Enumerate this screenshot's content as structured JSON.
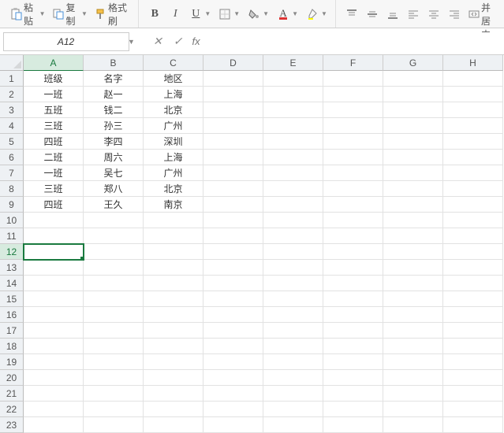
{
  "toolbar": {
    "paste_label": "粘贴",
    "copy_label": "复制",
    "format_painter_label": "格式刷",
    "merge_label": "合并居中"
  },
  "formula_bar": {
    "namebox_value": "A12",
    "fx_label": "fx",
    "formula_value": ""
  },
  "columns": [
    "A",
    "B",
    "C",
    "D",
    "E",
    "F",
    "G",
    "H"
  ],
  "row_count": 23,
  "active_cell": {
    "row": 12,
    "col": 1
  },
  "chart_data": {
    "type": "table",
    "headers": [
      "班级",
      "名字",
      "地区"
    ],
    "rows": [
      [
        "一班",
        "赵一",
        "上海"
      ],
      [
        "五班",
        "钱二",
        "北京"
      ],
      [
        "三班",
        "孙三",
        "广州"
      ],
      [
        "四班",
        "李四",
        "深圳"
      ],
      [
        "二班",
        "周六",
        "上海"
      ],
      [
        "一班",
        "吴七",
        "广州"
      ],
      [
        "三班",
        "郑八",
        "北京"
      ],
      [
        "四班",
        "王久",
        "南京"
      ]
    ]
  }
}
